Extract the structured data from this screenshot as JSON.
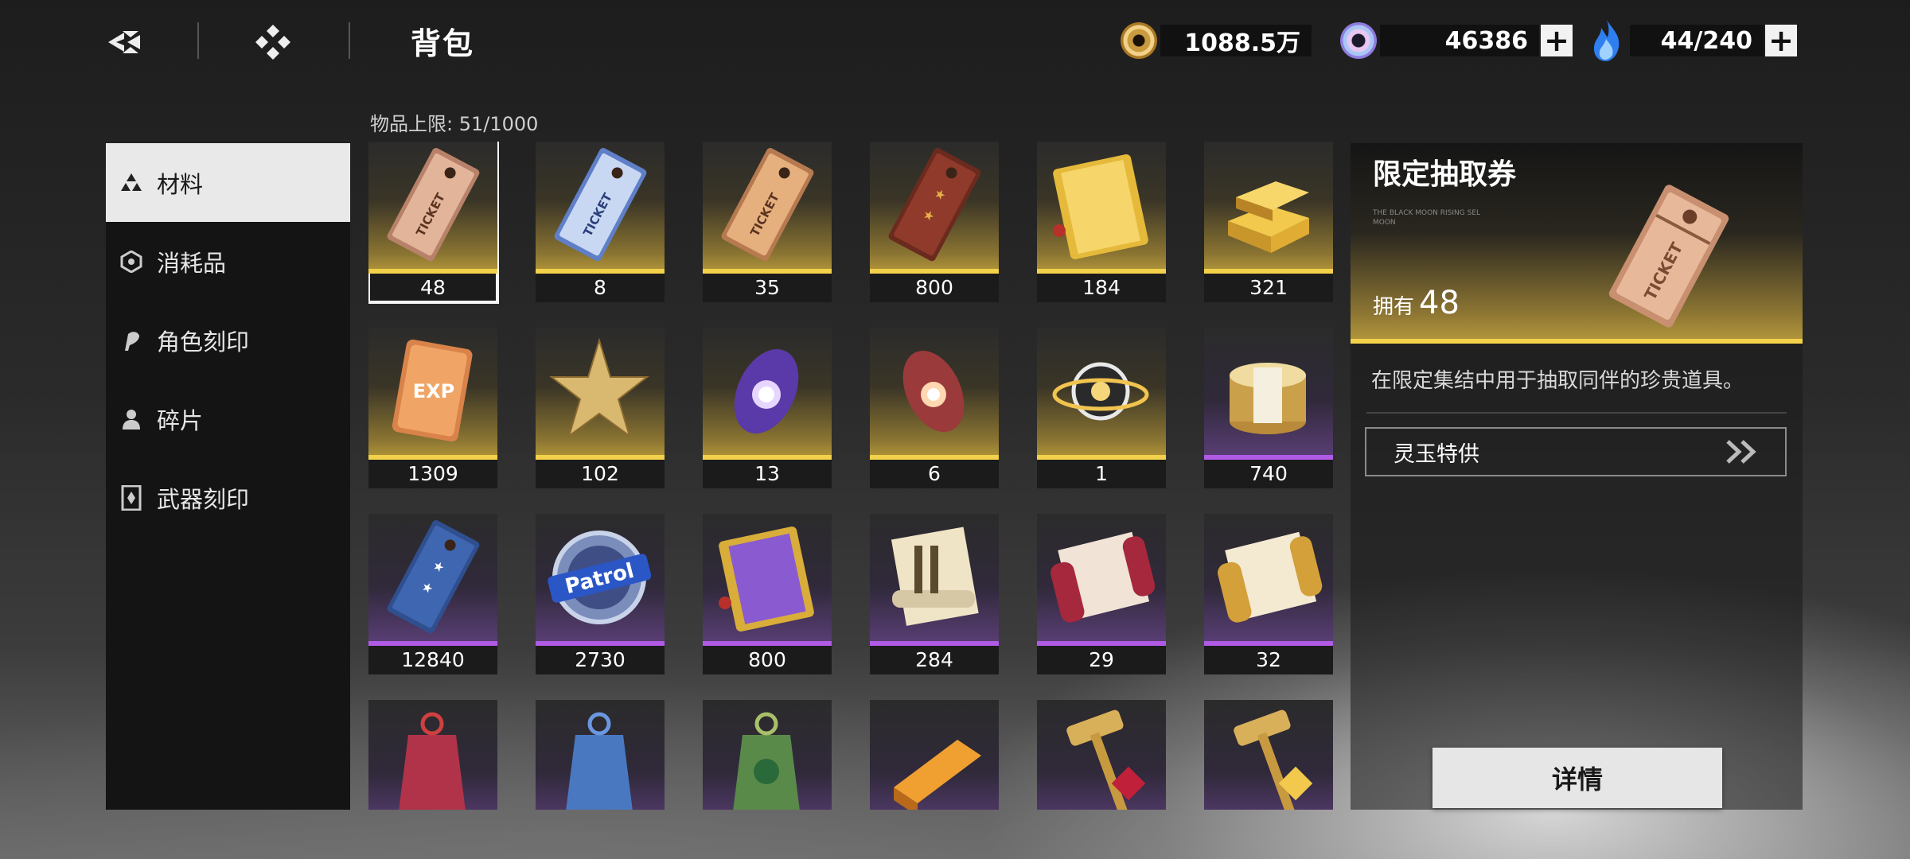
{
  "header": {
    "title": "背包",
    "currencies": [
      {
        "name": "gold-coin",
        "amount": "1088.5万",
        "has_plus": false
      },
      {
        "name": "spirit-jade",
        "amount": "46386",
        "has_plus": true
      },
      {
        "name": "stamina-flame",
        "amount": "44/240",
        "has_plus": true
      }
    ]
  },
  "sidebar": {
    "items": [
      {
        "label": "材料",
        "icon": "materials-icon",
        "active": true
      },
      {
        "label": "消耗品",
        "icon": "consumables-icon",
        "active": false
      },
      {
        "label": "角色刻印",
        "icon": "character-imprint-icon",
        "active": false
      },
      {
        "label": "碎片",
        "icon": "fragments-icon",
        "active": false
      },
      {
        "label": "武器刻印",
        "icon": "weapon-imprint-icon",
        "active": false
      }
    ]
  },
  "inventory": {
    "capacity_label": "物品上限: 51/1000",
    "items": [
      {
        "count": "48",
        "rarity": "gold",
        "art": "ticket-bronze",
        "selected": true
      },
      {
        "count": "8",
        "rarity": "gold",
        "art": "ticket-blue"
      },
      {
        "count": "35",
        "rarity": "gold",
        "art": "ticket-copper"
      },
      {
        "count": "800",
        "rarity": "gold",
        "art": "ticket-stars-red"
      },
      {
        "count": "184",
        "rarity": "gold",
        "art": "book-gold"
      },
      {
        "count": "321",
        "rarity": "gold",
        "art": "gold-bars"
      },
      {
        "count": "1309",
        "rarity": "gold",
        "art": "exp-card"
      },
      {
        "count": "102",
        "rarity": "gold",
        "art": "gold-star"
      },
      {
        "count": "13",
        "rarity": "gold",
        "art": "purple-crystal"
      },
      {
        "count": "6",
        "rarity": "gold",
        "art": "red-crystal"
      },
      {
        "count": "1",
        "rarity": "gold",
        "art": "orbit-orb"
      },
      {
        "count": "740",
        "rarity": "purple",
        "art": "coin-stack"
      },
      {
        "count": "12840",
        "rarity": "purple",
        "art": "ticket-stars-blue"
      },
      {
        "count": "2730",
        "rarity": "purple",
        "art": "patrol-badge"
      },
      {
        "count": "800",
        "rarity": "purple",
        "art": "book-purple"
      },
      {
        "count": "284",
        "rarity": "purple",
        "art": "scroll-stack"
      },
      {
        "count": "29",
        "rarity": "purple",
        "art": "scroll-red"
      },
      {
        "count": "32",
        "rarity": "purple",
        "art": "scroll-gold"
      },
      {
        "count": "",
        "rarity": "purple",
        "art": "charm-red"
      },
      {
        "count": "",
        "rarity": "purple",
        "art": "charm-blue"
      },
      {
        "count": "",
        "rarity": "purple",
        "art": "charm-green"
      },
      {
        "count": "",
        "rarity": "purple",
        "art": "ingot-orange"
      },
      {
        "count": "",
        "rarity": "purple",
        "art": "hammer-red"
      },
      {
        "count": "",
        "rarity": "purple",
        "art": "hammer-gold"
      }
    ]
  },
  "detail": {
    "title": "限定抽取券",
    "tiny_text": "THE BLACK MOON RISING\nSEL MOON",
    "owned_label": "拥有",
    "owned_count": "48",
    "description": "在限定集结中用于抽取同伴的珍贵道具。",
    "shop_button": "灵玉特供",
    "detail_button": "详情"
  },
  "colors": {
    "gold_rarity": "#f3d14a",
    "purple_rarity": "#b05ae6",
    "selected_outline": "#f4f4f4"
  }
}
